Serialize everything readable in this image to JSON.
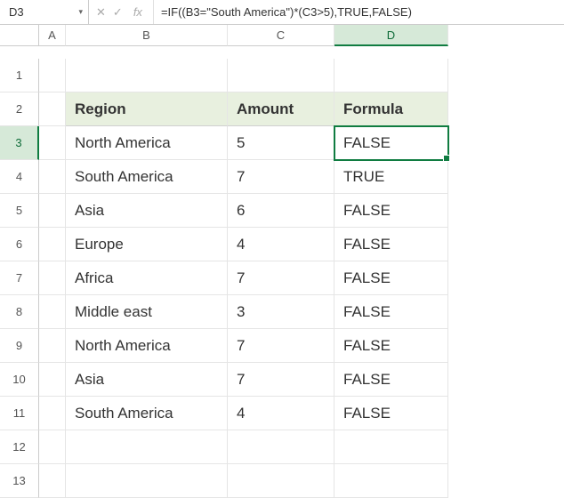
{
  "name_box": "D3",
  "formula": "=IF((B3=\"South America\")*(C3>5),TRUE,FALSE)",
  "columns": [
    "A",
    "B",
    "C",
    "D"
  ],
  "active_col_index": 3,
  "active_row_index": 2,
  "headers": [
    "Region",
    "Amount",
    "Formula"
  ],
  "rows": [
    {
      "region": "North America",
      "amount": "5",
      "formula": "FALSE"
    },
    {
      "region": "South America",
      "amount": "7",
      "formula": "TRUE"
    },
    {
      "region": "Asia",
      "amount": "6",
      "formula": "FALSE"
    },
    {
      "region": "Europe",
      "amount": "4",
      "formula": "FALSE"
    },
    {
      "region": "Africa",
      "amount": "7",
      "formula": "FALSE"
    },
    {
      "region": "Middle east",
      "amount": "3",
      "formula": "FALSE"
    },
    {
      "region": "North America",
      "amount": "7",
      "formula": "FALSE"
    },
    {
      "region": "Asia",
      "amount": "7",
      "formula": "FALSE"
    },
    {
      "region": "South America",
      "amount": "4",
      "formula": "FALSE"
    }
  ],
  "chart_data": {
    "type": "table",
    "title": "",
    "columns": [
      "Region",
      "Amount",
      "Formula"
    ],
    "data": [
      [
        "North America",
        5,
        "FALSE"
      ],
      [
        "South America",
        7,
        "TRUE"
      ],
      [
        "Asia",
        6,
        "FALSE"
      ],
      [
        "Europe",
        4,
        "FALSE"
      ],
      [
        "Africa",
        7,
        "FALSE"
      ],
      [
        "Middle east",
        3,
        "FALSE"
      ],
      [
        "North America",
        7,
        "FALSE"
      ],
      [
        "Asia",
        7,
        "FALSE"
      ],
      [
        "South America",
        4,
        "FALSE"
      ]
    ]
  }
}
